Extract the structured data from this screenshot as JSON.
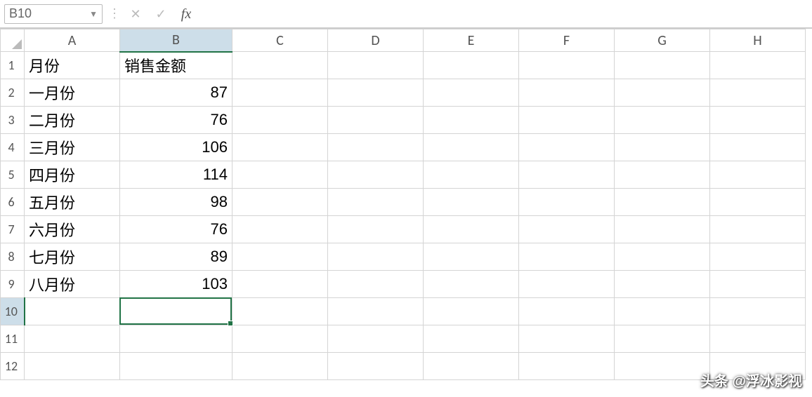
{
  "formula_bar": {
    "name_box_value": "B10",
    "cancel_icon": "✕",
    "enter_icon": "✓",
    "fx_icon": "fx",
    "formula_value": ""
  },
  "columns": [
    "A",
    "B",
    "C",
    "D",
    "E",
    "F",
    "G",
    "H"
  ],
  "row_numbers": [
    1,
    2,
    3,
    4,
    5,
    6,
    7,
    8,
    9,
    10,
    11,
    12
  ],
  "selected_col_index": 1,
  "selected_row_index": 9,
  "cells": [
    {
      "A": "月份",
      "B": "销售金额"
    },
    {
      "A": "一月份",
      "B": 87
    },
    {
      "A": "二月份",
      "B": 76
    },
    {
      "A": "三月份",
      "B": 106
    },
    {
      "A": "四月份",
      "B": 114
    },
    {
      "A": "五月份",
      "B": 98
    },
    {
      "A": "六月份",
      "B": 76
    },
    {
      "A": "七月份",
      "B": 89
    },
    {
      "A": "八月份",
      "B": 103
    },
    {
      "A": "",
      "B": ""
    },
    {
      "A": "",
      "B": ""
    },
    {
      "A": "",
      "B": ""
    }
  ],
  "chart_data": {
    "type": "table",
    "title": "",
    "columns": [
      "月份",
      "销售金额"
    ],
    "rows": [
      [
        "一月份",
        87
      ],
      [
        "二月份",
        76
      ],
      [
        "三月份",
        106
      ],
      [
        "四月份",
        114
      ],
      [
        "五月份",
        98
      ],
      [
        "六月份",
        76
      ],
      [
        "七月份",
        89
      ],
      [
        "八月份",
        103
      ]
    ]
  },
  "watermark": "头条 @浮冰影视"
}
